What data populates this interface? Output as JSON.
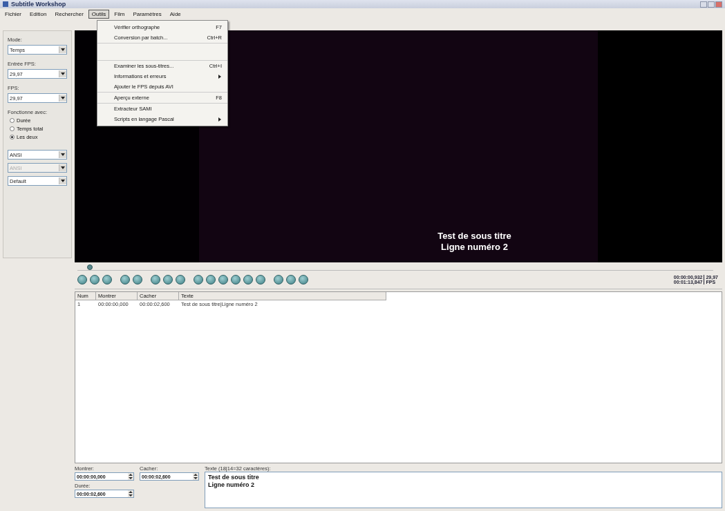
{
  "window": {
    "title": "Subtitle Workshop"
  },
  "menu_bar": [
    {
      "label": "Fichier",
      "selected": false
    },
    {
      "label": "Edition",
      "selected": false
    },
    {
      "label": "Rechercher",
      "selected": false
    },
    {
      "label": "Outils",
      "selected": true
    },
    {
      "label": "Film",
      "selected": false
    },
    {
      "label": "Paramètres",
      "selected": false
    },
    {
      "label": "Aide",
      "selected": false
    }
  ],
  "open_menu": [
    {
      "kind": "item",
      "label": "Vérifier orthographe",
      "shortcut": "F7",
      "submenu": false,
      "divider_after": false
    },
    {
      "kind": "item",
      "label": "Conversion par batch...",
      "shortcut": "Ctrl+R",
      "submenu": false,
      "divider_after": false
    },
    {
      "kind": "gap"
    },
    {
      "kind": "item",
      "label": "Examiner les sous-titres...",
      "shortcut": "Ctrl+I",
      "submenu": false,
      "divider_after": false
    },
    {
      "kind": "item",
      "label": "Informations et erreurs",
      "submenu": true,
      "divider_after": false
    },
    {
      "kind": "item",
      "label": "Ajouter le FPS depuis AVI",
      "submenu": false,
      "divider_after": true
    },
    {
      "kind": "item",
      "label": "Aperçu externe",
      "shortcut": "F8",
      "submenu": false,
      "divider_after": true
    },
    {
      "kind": "item",
      "label": "Extracteur SAMI",
      "submenu": false,
      "divider_after": false
    },
    {
      "kind": "item",
      "label": "Scripts en langage Pascal",
      "submenu": true,
      "divider_after": false
    }
  ],
  "side_panel": {
    "fields": [
      {
        "label": "Mode:",
        "value": "Temps"
      },
      {
        "label": "Entrée FPS:",
        "value": "29,97"
      },
      {
        "label": "FPS:",
        "value": "29,97"
      }
    ],
    "works_with": {
      "label": "Fonctionne avec:",
      "options": [
        {
          "label": "Durée",
          "selected": false
        },
        {
          "label": "Temps total",
          "selected": false
        },
        {
          "label": "Les deux",
          "selected": true
        }
      ]
    },
    "combos": [
      {
        "value": "ANSI",
        "disabled": false
      },
      {
        "value": "ANSI",
        "disabled": true
      },
      {
        "value": "Default",
        "disabled": false
      }
    ]
  },
  "video": {
    "subtitle_lines": [
      "Test de sous titre",
      "Ligne numéro 2"
    ],
    "level": 0.015
  },
  "time_display": {
    "current": "00:00:00,932",
    "total": "00:01:13,847",
    "fps": "29,97",
    "fps_label": "FPS"
  },
  "table": {
    "columns": [
      "Num",
      "Montrer",
      "Cacher",
      "Texte"
    ],
    "rows": [
      {
        "selected": false,
        "cells": [
          "1",
          "00:00:00,000",
          "00:00:02,600",
          "Test de sous titre|Ligne numéro 2"
        ]
      }
    ]
  },
  "editor": {
    "show_label": "Montrer:",
    "show": "00:00:00,000",
    "hide_label": "Cacher:",
    "hide": "00:00:02,600",
    "duration_label": "Durée:",
    "duration": "00:00:02,600",
    "text_label": "Texte (18|14=32 caractères):",
    "text_lines": [
      "Test de sous titre",
      "Ligne numéro 2"
    ]
  }
}
